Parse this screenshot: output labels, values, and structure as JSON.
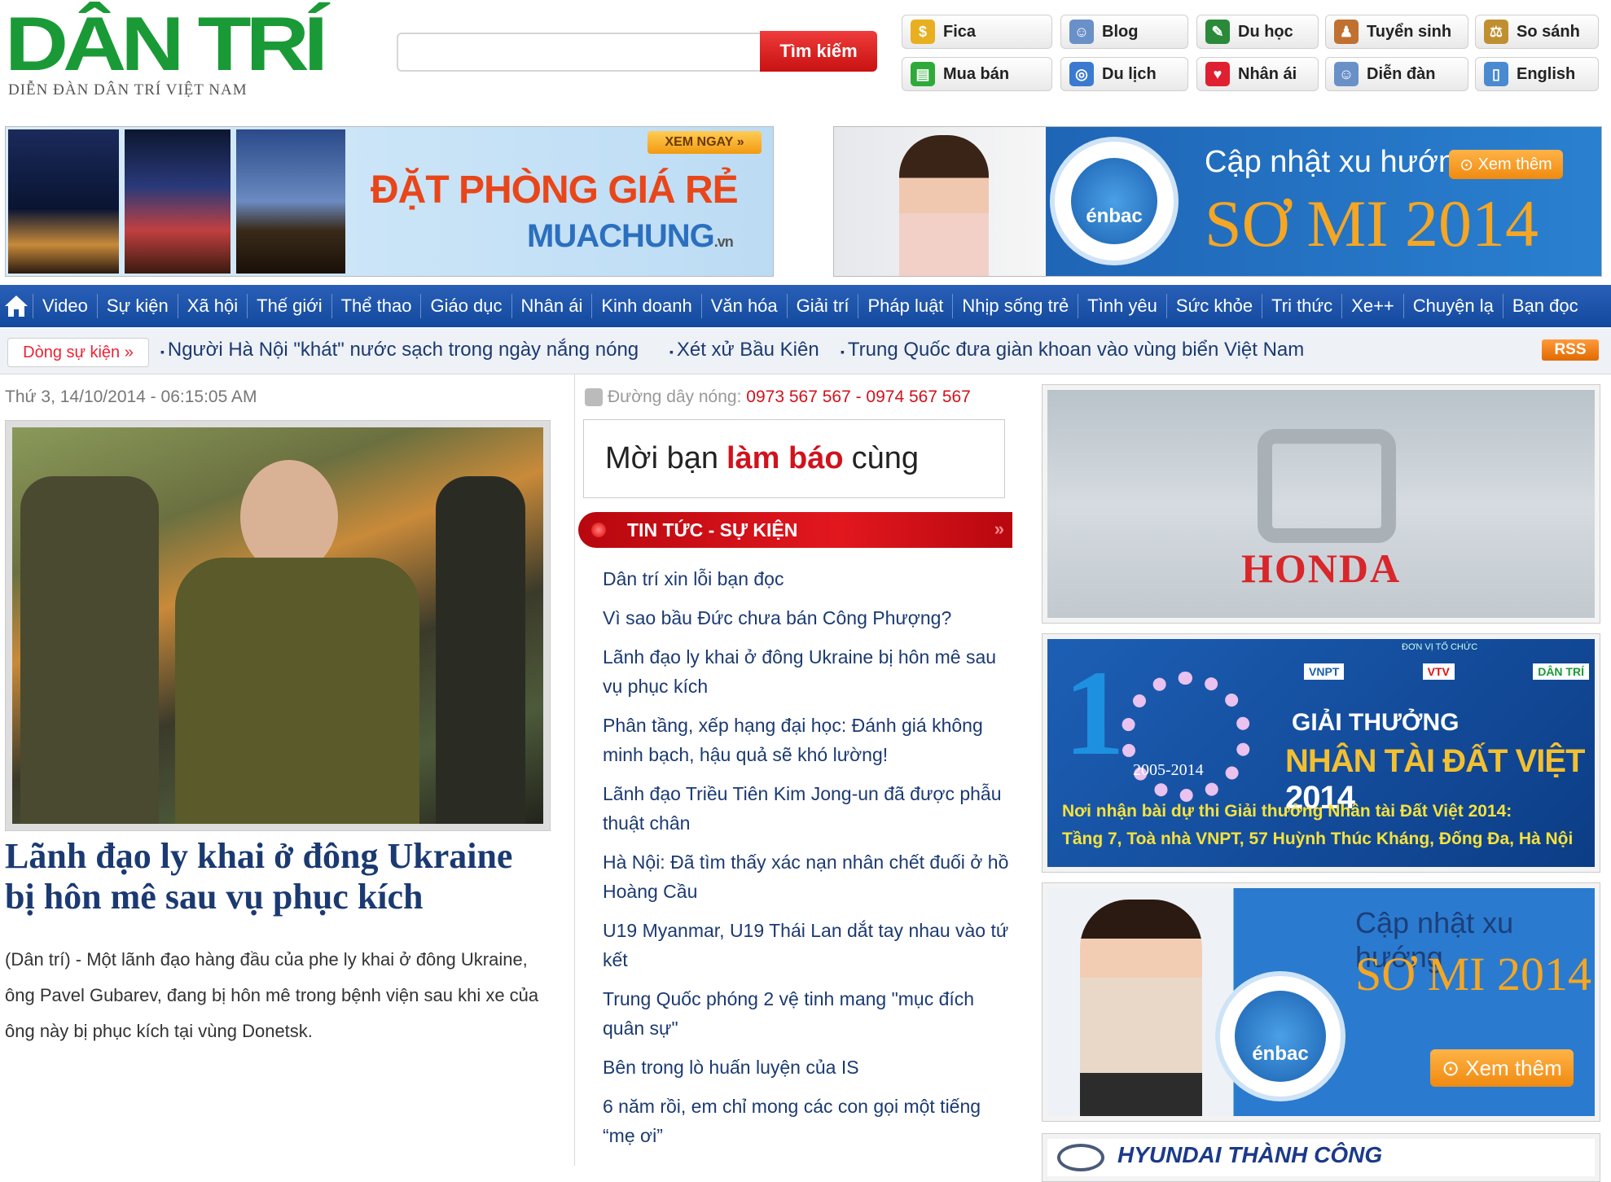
{
  "header": {
    "logo_text": "DÂN TRÍ",
    "logo_sub": "DIỄN ĐÀN DÂN TRÍ VIỆT NAM",
    "search_placeholder": "",
    "search_button": "Tìm kiếm",
    "quick_links": [
      {
        "label": "Fica",
        "icon": "coins-icon"
      },
      {
        "label": "Blog",
        "icon": "people-icon"
      },
      {
        "label": "Du học",
        "icon": "graduation-cap-icon"
      },
      {
        "label": "Tuyển sinh",
        "icon": "student-icon"
      },
      {
        "label": "So sánh",
        "icon": "scales-icon"
      },
      {
        "label": "Mua bán",
        "icon": "shopping-bag-icon"
      },
      {
        "label": "Du lịch",
        "icon": "globe-icon"
      },
      {
        "label": "Nhân ái",
        "icon": "heart-icon"
      },
      {
        "label": "Diễn đàn",
        "icon": "forum-icon"
      },
      {
        "label": "English",
        "icon": "book-icon"
      }
    ]
  },
  "banner_left": {
    "cta": "XEM NGAY",
    "headline": "ĐẶT PHÒNG GIÁ RẺ",
    "brand": "MUACHUNG",
    "brand_tld": ".vn"
  },
  "banner_right": {
    "line1": "Cập nhật xu hướng",
    "cta": "Xem thêm",
    "line2": "SƠ MI 2014",
    "brand": "énbac"
  },
  "nav": {
    "items": [
      "Video",
      "Sự kiện",
      "Xã hội",
      "Thế giới",
      "Thể thao",
      "Giáo dục",
      "Nhân ái",
      "Kinh doanh",
      "Văn hóa",
      "Giải trí",
      "Pháp luật",
      "Nhịp sống trẻ",
      "Tình yêu",
      "Sức khỏe",
      "Tri thức",
      "Xe++",
      "Chuyện lạ",
      "Bạn đọc"
    ]
  },
  "ticker": {
    "label": "Dòng sự kiện »",
    "items": [
      "Người Hà Nội \"khát\" nước sạch trong ngày nắng nóng",
      "Xét xử Bầu Kiên",
      "Trung Quốc đưa giàn khoan vào vùng biển Việt Nam"
    ],
    "rss": "RSS"
  },
  "left": {
    "date": "Thứ 3, 14/10/2014 - 06:15:05 AM",
    "lead_title": "Lãnh đạo ly khai ở đông Ukraine bị hôn mê sau vụ phục kích",
    "lead_summary": "(Dân trí) - Một lãnh đạo hàng đầu của phe ly khai ở đông Ukraine, ông Pavel Gubarev, đang bị hôn mê trong bệnh viện sau khi xe của ông này bị phục kích tại vùng Donetsk."
  },
  "middle": {
    "hotline_label": "Đường dây nóng:",
    "hotline_numbers": "0973 567 567 - 0974 567 567",
    "invite_pre": "Mời bạn",
    "invite_bold": "làm báo",
    "invite_post": "cùng",
    "category": "TIN TỨC - SỰ KIỆN",
    "news": [
      "Dân trí xin lỗi bạn đọc",
      "Vì sao bầu Đức chưa bán Công Phượng?",
      "Lãnh đạo ly khai ở đông Ukraine bị hôn mê sau vụ phục kích",
      "Phân tầng, xếp hạng đại học: Đánh giá không minh bạch, hậu quả sẽ khó lường!",
      "Lãnh đạo Triều Tiên Kim Jong-un đã được phẫu thuật chân",
      "Hà Nội: Đã tìm thấy xác nạn nhân chết đuối ở hồ Hoàng Cầu",
      "U19 Myanmar, U19 Thái Lan dắt tay nhau vào tứ kết",
      "Trung Quốc phóng 2 vệ tinh mang \"mục đích quân sự\"",
      "Bên trong lò huấn luyện của IS",
      "6 năm rồi, em chỉ mong các con gọi một tiếng “mẹ ơi”"
    ]
  },
  "right": {
    "honda": "HONDA",
    "award_org": "ĐƠN VỊ TỔ CHỨC",
    "award_orgs": [
      "VNPT",
      "VTV",
      "DÂN TRÍ"
    ],
    "award_years": "2005-2014",
    "award_title": "GIẢI THƯỞNG",
    "award_name": "NHÂN TÀI ĐẤT VIỆT",
    "award_year": "2014",
    "award_line1": "Nơi nhận bài dự thi Giải thưởng Nhân tài Đất Việt 2014:",
    "award_line2": "Tầng 7, Toà nhà VNPT, 57 Huỳnh Thúc Kháng, Đống Đa, Hà Nội",
    "enbac_line1": "Cập nhật xu hướng",
    "enbac_line2": "SƠ MI 2014",
    "enbac_cta": "Xem thêm",
    "enbac_brand": "énbac",
    "hyundai": "HYUNDAI THÀNH CÔNG"
  }
}
